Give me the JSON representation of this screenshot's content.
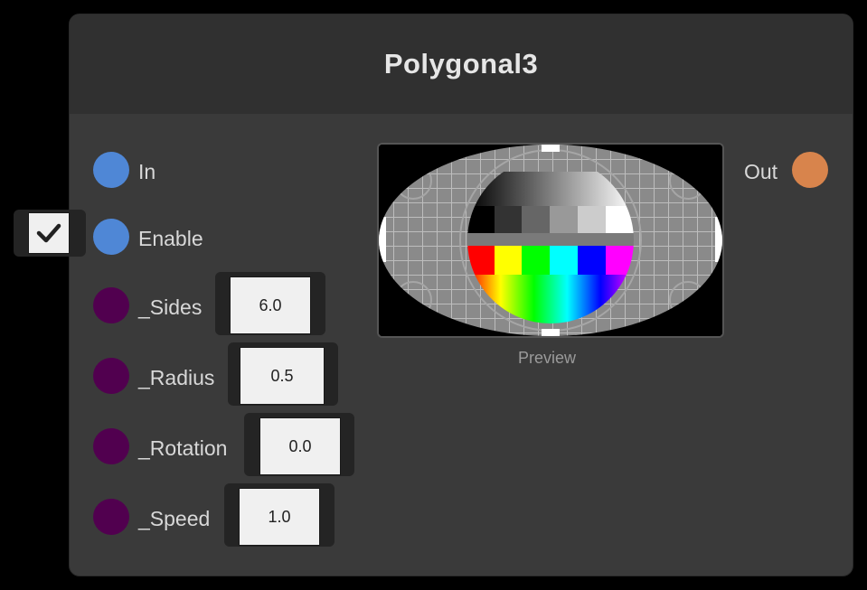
{
  "node": {
    "title": "Polygonal3",
    "inputs": [
      {
        "label": "In",
        "type": "flow"
      },
      {
        "label": "Enable",
        "type": "flow",
        "checked": true
      },
      {
        "label": "_Sides",
        "value": "6.0"
      },
      {
        "label": "_Radius",
        "value": "0.5"
      },
      {
        "label": "_Rotation",
        "value": "0.0"
      },
      {
        "label": "_Speed",
        "value": "1.0"
      }
    ],
    "output": {
      "label": "Out"
    },
    "preview_label": "Preview"
  },
  "colors": {
    "flow_port": "#4f87d6",
    "param_port": "#51004f",
    "output_port": "#d8844c",
    "node_bg": "#3a3a3a",
    "header_bg": "#303030"
  },
  "icons": {
    "checkbox": "check-icon"
  }
}
